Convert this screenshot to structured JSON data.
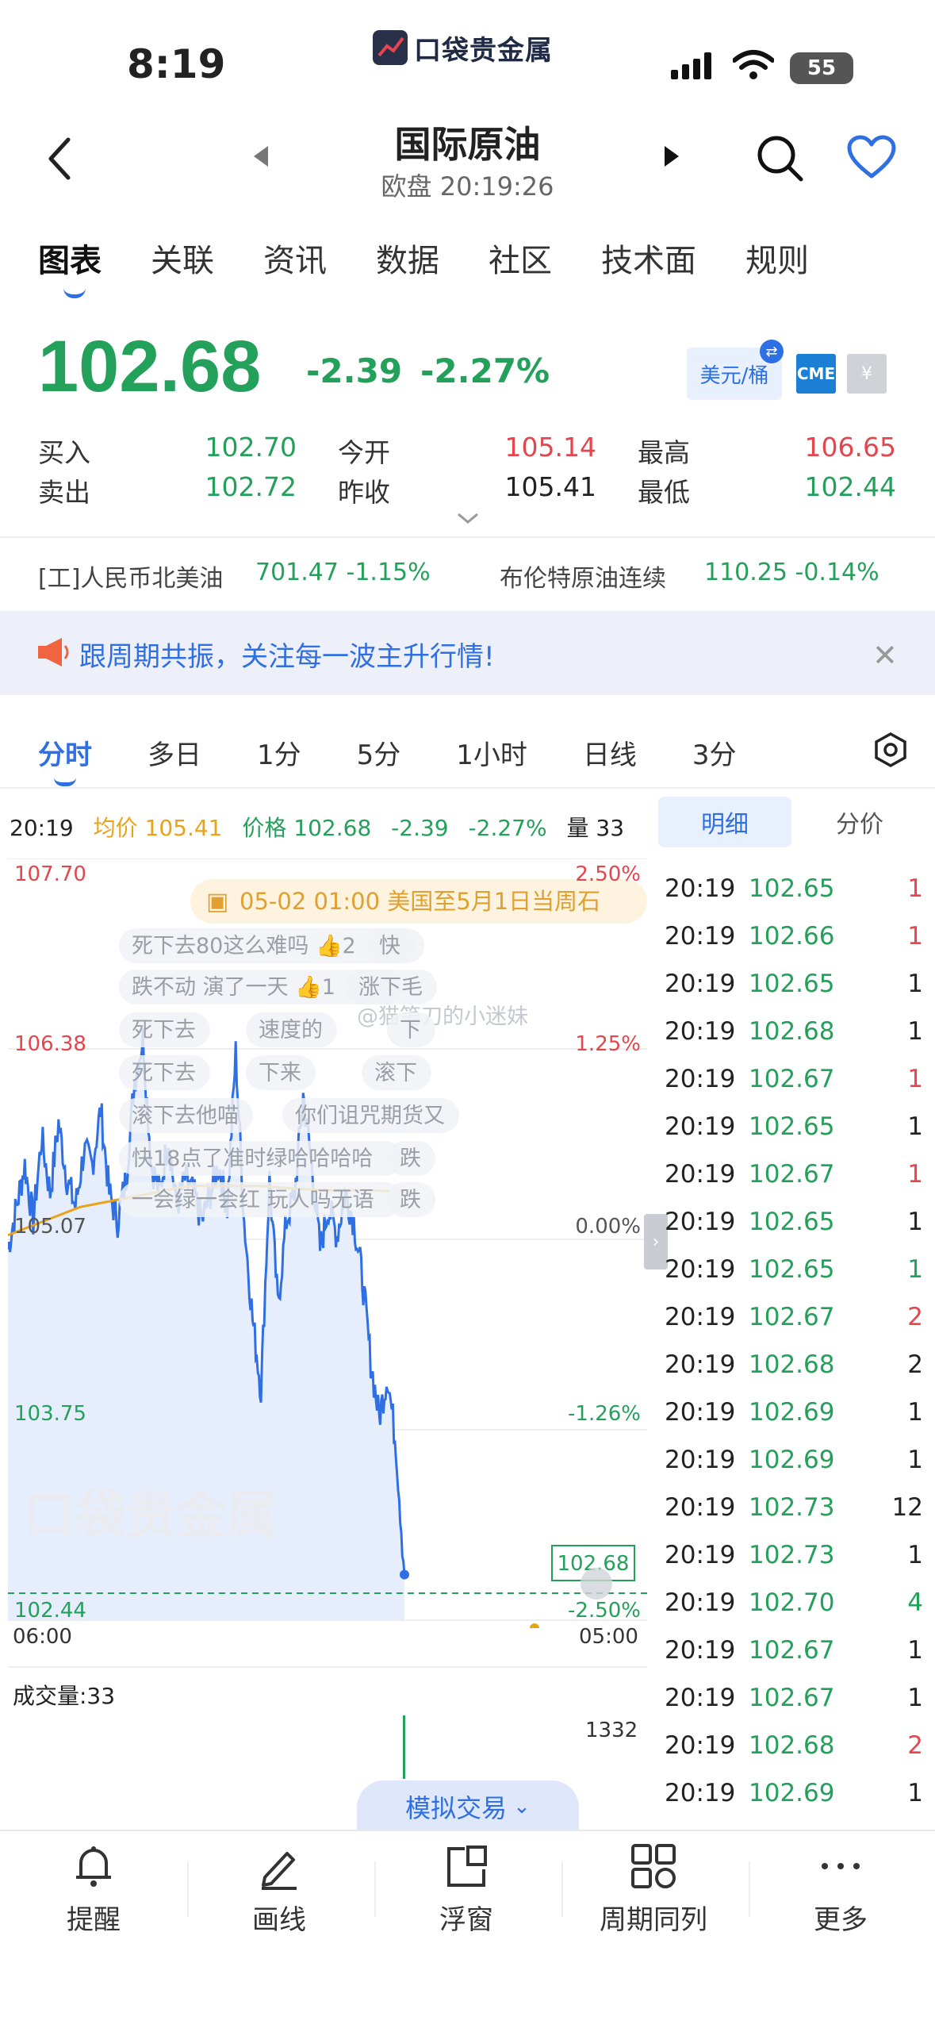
{
  "status": {
    "time": "8:19",
    "battery": "55"
  },
  "app": {
    "logo_text": "口袋贵金属"
  },
  "nav": {
    "title": "国际原油",
    "subtitle": "欧盘 20:19:26"
  },
  "main_tabs": [
    "图表",
    "关联",
    "资讯",
    "数据",
    "社区",
    "技术面",
    "规则"
  ],
  "quote": {
    "price": "102.68",
    "change": "-2.39",
    "change_pct": "-2.27%",
    "unit": "美元/桶",
    "exchange_badge": "CME",
    "bid_label": "买入",
    "bid": "102.70",
    "ask_label": "卖出",
    "ask": "102.72",
    "open_label": "今开",
    "open": "105.14",
    "prev_close_label": "昨收",
    "prev_close": "105.41",
    "high_label": "最高",
    "high": "106.65",
    "low_label": "最低",
    "low": "102.44"
  },
  "related": [
    {
      "name": "[工]人民币北美油",
      "value": "701.47 -1.15%"
    },
    {
      "name": "布伦特原油连续",
      "value": "110.25 -0.14%"
    }
  ],
  "banner": {
    "text": "跟周期共振，关注每一波主升行情!"
  },
  "period_tabs": [
    "分时",
    "多日",
    "1分",
    "5分",
    "1小时",
    "日线",
    "3分"
  ],
  "info_line": {
    "time": "20:19",
    "avg": "均价 105.41",
    "price": "价格 102.68",
    "change": "-2.39",
    "change_pct": "-2.27%",
    "volume": "量 33"
  },
  "chart": {
    "y_left": [
      "107.70",
      "106.38",
      "105.07",
      "103.75",
      "102.44"
    ],
    "y_right": [
      "2.50%",
      "1.25%",
      "0.00%",
      "-1.26%",
      "-2.50%"
    ],
    "x_start": "06:00",
    "x_end": "05:00",
    "current_price_tag": "102.68",
    "event_text": "05-02 01:00 美国至5月1日当周石",
    "watermark": "@猫笔刀的小迷妹",
    "danmaku": [
      {
        "text": "死下去80这么难吗",
        "likes": "2"
      },
      {
        "text": "快",
        "likes": ""
      },
      {
        "text": "跌不动 演了一天",
        "likes": "1"
      },
      {
        "text": "涨下毛",
        "likes": ""
      },
      {
        "text": "死下去",
        "likes": ""
      },
      {
        "text": "速度的",
        "likes": ""
      },
      {
        "text": "下",
        "likes": ""
      },
      {
        "text": "死下去",
        "likes": ""
      },
      {
        "text": "下来",
        "likes": ""
      },
      {
        "text": "滚下",
        "likes": ""
      },
      {
        "text": "滚下去他喵",
        "likes": ""
      },
      {
        "text": "你们诅咒期货又",
        "likes": ""
      },
      {
        "text": "快18点了准时绿哈哈哈哈",
        "likes": ""
      },
      {
        "text": "跌",
        "likes": ""
      },
      {
        "text": "一会绿一会红 玩人吗无语",
        "likes": ""
      },
      {
        "text": "跌",
        "likes": ""
      }
    ]
  },
  "chart_data": {
    "type": "line",
    "x_range": [
      "06:00",
      "05:00"
    ],
    "ylim": [
      102.44,
      107.7
    ],
    "series": [
      {
        "values": [
          105.0,
          105.3,
          105.6,
          105.2,
          105.8,
          105.4,
          105.9,
          105.5,
          105.3,
          105.7,
          105.6,
          106.0,
          105.4,
          105.2,
          105.5,
          106.2,
          106.5,
          105.6,
          105.4,
          105.8,
          105.3,
          105.5,
          105.4,
          105.2,
          105.4,
          105.6,
          105.3,
          106.4,
          105.2,
          104.5,
          104.0,
          105.5,
          104.6,
          105.2,
          105.4,
          106.1,
          105.6,
          105.0,
          105.3,
          105.1,
          105.4,
          105.2,
          104.8,
          104.2,
          103.8,
          104.1,
          103.6,
          102.68
        ]
      },
      {
        "values": [
          105.1,
          105.2,
          105.3,
          105.35,
          105.4,
          105.45,
          105.45,
          105.45,
          105.43,
          105.42,
          105.42,
          105.41
        ]
      }
    ]
  },
  "volume": {
    "label": "成交量:33",
    "max": "1332"
  },
  "right_tabs": [
    "明细",
    "分价"
  ],
  "trades": [
    {
      "time": "20:19",
      "price": "102.65",
      "vol": "1",
      "dir": "red"
    },
    {
      "time": "20:19",
      "price": "102.66",
      "vol": "1",
      "dir": "red"
    },
    {
      "time": "20:19",
      "price": "102.65",
      "vol": "1",
      "dir": "dark"
    },
    {
      "time": "20:19",
      "price": "102.68",
      "vol": "1",
      "dir": "dark"
    },
    {
      "time": "20:19",
      "price": "102.67",
      "vol": "1",
      "dir": "red"
    },
    {
      "time": "20:19",
      "price": "102.65",
      "vol": "1",
      "dir": "dark"
    },
    {
      "time": "20:19",
      "price": "102.67",
      "vol": "1",
      "dir": "red"
    },
    {
      "time": "20:19",
      "price": "102.65",
      "vol": "1",
      "dir": "dark"
    },
    {
      "time": "20:19",
      "price": "102.65",
      "vol": "1",
      "dir": "green"
    },
    {
      "time": "20:19",
      "price": "102.67",
      "vol": "2",
      "dir": "red"
    },
    {
      "time": "20:19",
      "price": "102.68",
      "vol": "2",
      "dir": "dark"
    },
    {
      "time": "20:19",
      "price": "102.69",
      "vol": "1",
      "dir": "dark"
    },
    {
      "time": "20:19",
      "price": "102.69",
      "vol": "1",
      "dir": "dark"
    },
    {
      "time": "20:19",
      "price": "102.73",
      "vol": "12",
      "dir": "dark"
    },
    {
      "time": "20:19",
      "price": "102.73",
      "vol": "1",
      "dir": "dark"
    },
    {
      "time": "20:19",
      "price": "102.70",
      "vol": "4",
      "dir": "green"
    },
    {
      "time": "20:19",
      "price": "102.67",
      "vol": "1",
      "dir": "dark"
    },
    {
      "time": "20:19",
      "price": "102.67",
      "vol": "1",
      "dir": "dark"
    },
    {
      "time": "20:19",
      "price": "102.68",
      "vol": "2",
      "dir": "red"
    },
    {
      "time": "20:19",
      "price": "102.69",
      "vol": "1",
      "dir": "dark"
    }
  ],
  "sim_trade": "模拟交易",
  "bottom_bar": [
    "提醒",
    "画线",
    "浮窗",
    "周期同列",
    "更多"
  ],
  "colors": {
    "green": "#23a05a",
    "red": "#e5454c",
    "accent": "#2f6fe4",
    "avg_line": "#e8a317"
  }
}
